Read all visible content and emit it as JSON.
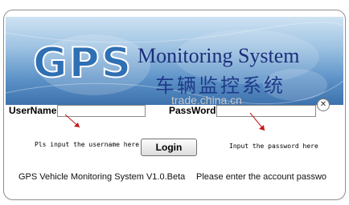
{
  "banner": {
    "logo_text": "GPS",
    "title_en": "Monitoring System",
    "title_cn": "车辆监控系统"
  },
  "watermark": "trade.china.cn",
  "form": {
    "username_label": "UserName:",
    "username_value": "",
    "password_label": "PassWord:",
    "password_value": "",
    "username_hint": "Pls input the username here",
    "password_hint": "Input the password here",
    "login_label": "Login"
  },
  "status": {
    "version": "GPS Vehicle Monitoring System V1.0.Beta",
    "message": "Please enter the account passwo"
  },
  "close_glyph": "✕",
  "colors": {
    "banner_dark": "#3c72ad",
    "arrow": "#c41a1a"
  }
}
